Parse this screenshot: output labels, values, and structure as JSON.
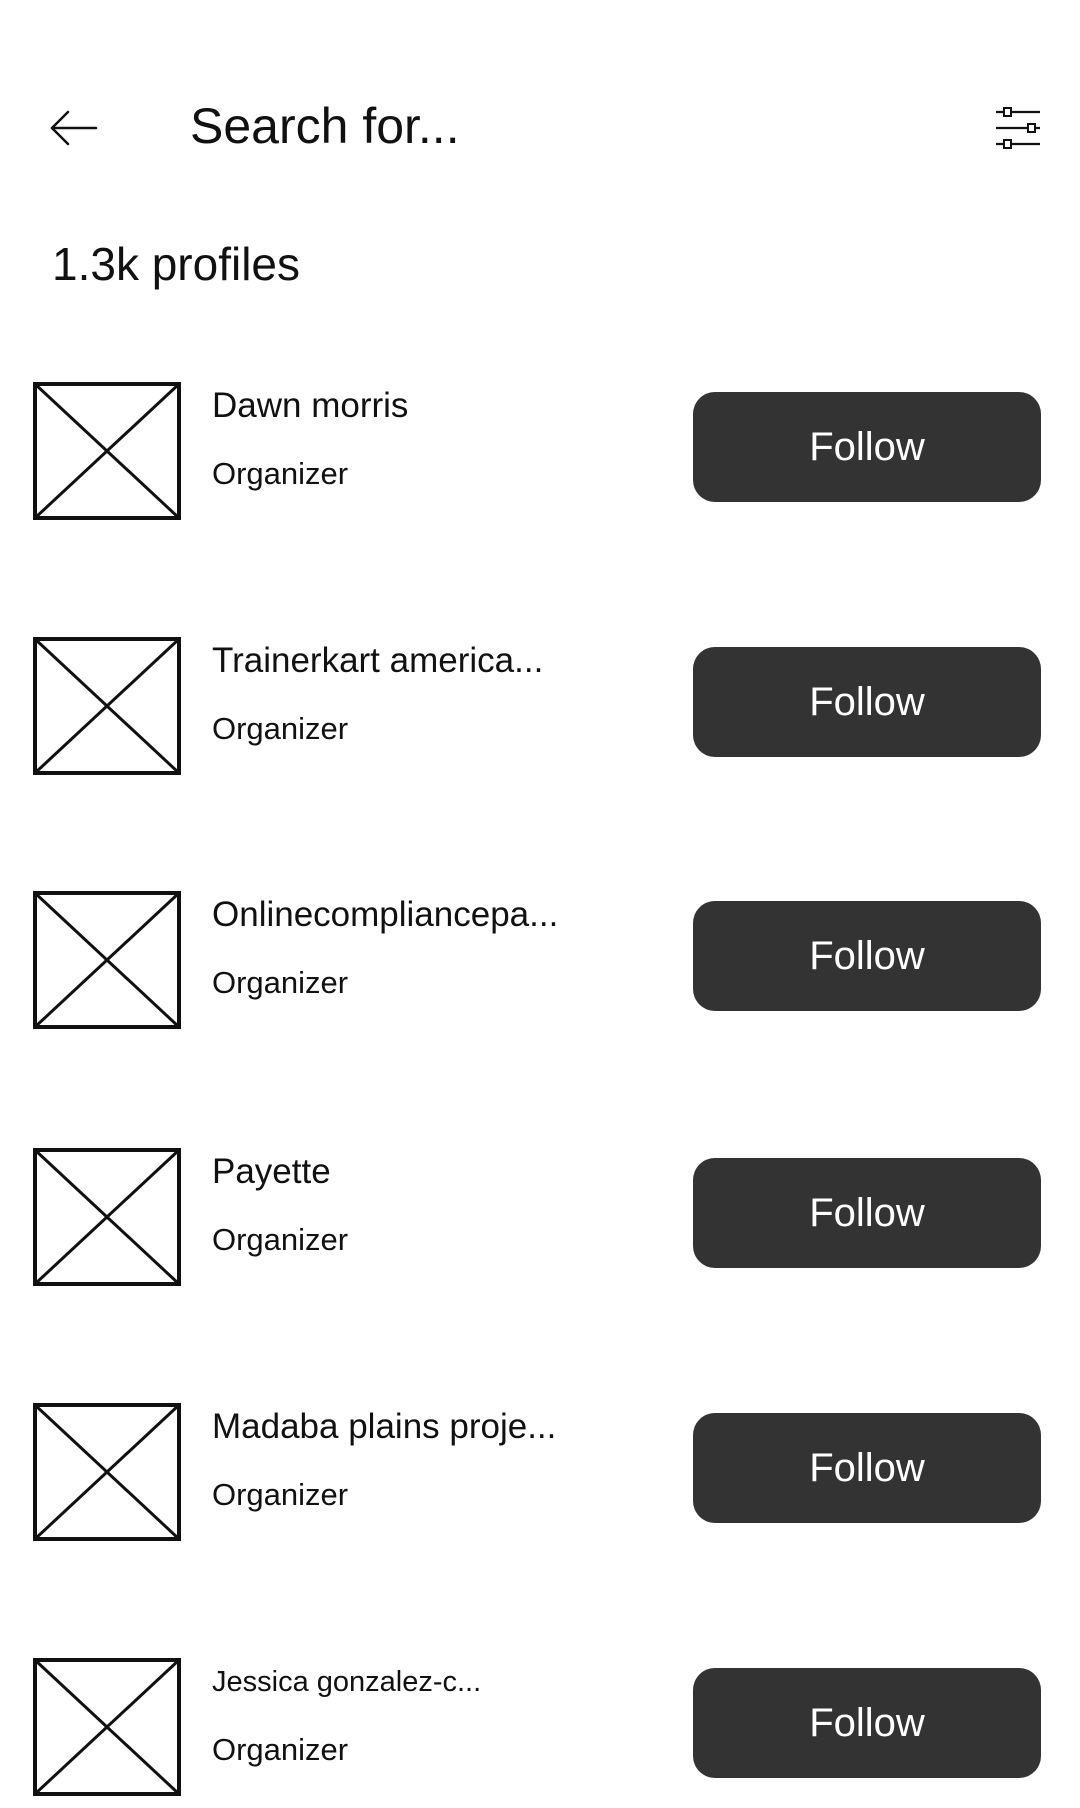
{
  "header": {
    "back_icon": "arrow-left-icon",
    "search_placeholder": "Search for...",
    "filter_icon": "sliders-icon"
  },
  "results": {
    "count_label": "1.3k profiles"
  },
  "profiles": [
    {
      "name": "Dawn morris",
      "role": "Organizer",
      "follow_label": "Follow",
      "avatar_icon": "image-placeholder-icon"
    },
    {
      "name": "Trainerkart america...",
      "role": "Organizer",
      "follow_label": "Follow",
      "avatar_icon": "image-placeholder-icon"
    },
    {
      "name": "Onlinecompliancepa...",
      "role": "Organizer",
      "follow_label": "Follow",
      "avatar_icon": "image-placeholder-icon"
    },
    {
      "name": "Payette",
      "role": "Organizer",
      "follow_label": "Follow",
      "avatar_icon": "image-placeholder-icon"
    },
    {
      "name": "Madaba plains proje...",
      "role": "Organizer",
      "follow_label": "Follow",
      "avatar_icon": "image-placeholder-icon"
    },
    {
      "name": "Jessica gonzalez-c...",
      "role": "Organizer",
      "follow_label": "Follow",
      "avatar_icon": "image-placeholder-icon"
    }
  ],
  "colors": {
    "button_bg": "#333333",
    "button_text": "#ffffff",
    "text": "#111111",
    "background": "#ffffff"
  }
}
